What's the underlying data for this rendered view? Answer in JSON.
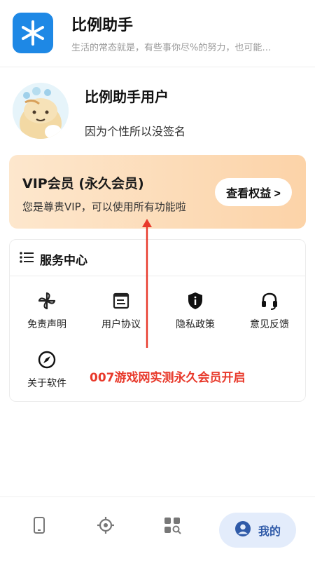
{
  "header": {
    "app_title": "比例助手",
    "subtitle": "生活的常态就是，有些事你尽%的努力，也可能…"
  },
  "profile": {
    "name": "比例助手用户",
    "signature": "因为个性所以没签名"
  },
  "vip": {
    "title": "VIP会员 (永久会员)",
    "description": "您是尊贵VIP，可以使用所有功能啦",
    "button_label": "查看权益 >"
  },
  "service": {
    "title": "服务中心",
    "items": [
      {
        "label": "免责声明",
        "icon": "pinwheel-icon"
      },
      {
        "label": "用户协议",
        "icon": "document-icon"
      },
      {
        "label": "隐私政策",
        "icon": "shield-icon"
      },
      {
        "label": "意见反馈",
        "icon": "headset-icon"
      },
      {
        "label": "关于软件",
        "icon": "compass-icon"
      }
    ]
  },
  "annotation": {
    "text": "007游戏网实测永久会员开启",
    "color": "#e8392b"
  },
  "bottom_nav": {
    "items": [
      {
        "icon": "phone-icon"
      },
      {
        "icon": "target-icon"
      },
      {
        "icon": "apps-search-icon"
      },
      {
        "icon": "user-icon",
        "label": "我的",
        "active": true
      }
    ]
  },
  "colors": {
    "brand": "#1e88e5",
    "vip_gradient_start": "#fde7cd",
    "vip_gradient_end": "#fcd3a8",
    "nav_active_bg": "#e3ecfb",
    "nav_active_text": "#2f5aa8"
  }
}
